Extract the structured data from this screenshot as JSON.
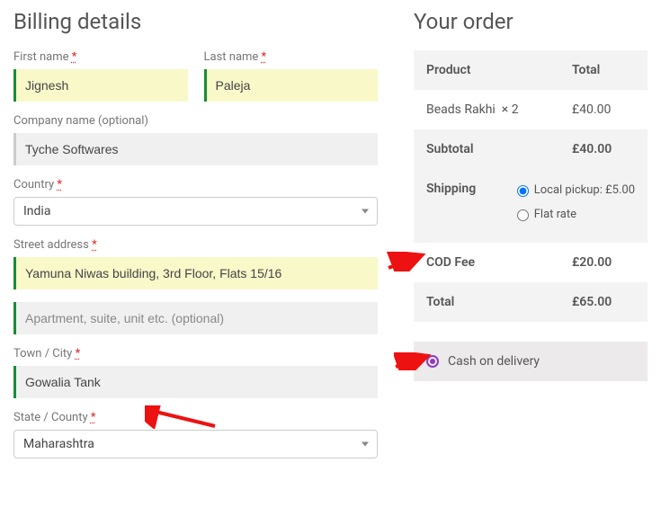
{
  "billing": {
    "heading": "Billing details",
    "first_name": {
      "label": "First name",
      "value": "Jignesh"
    },
    "last_name": {
      "label": "Last name",
      "value": "Paleja"
    },
    "company": {
      "label": "Company name (optional)",
      "value": "Tyche Softwares"
    },
    "country": {
      "label": "Country",
      "value": "India"
    },
    "street": {
      "label": "Street address",
      "value": "Yamuna Niwas building, 3rd Floor, Flats 15/16"
    },
    "street2_placeholder": "Apartment, suite, unit etc. (optional)",
    "city": {
      "label": "Town / City",
      "value": "Gowalia Tank"
    },
    "state": {
      "label": "State / County",
      "value": "Maharashtra"
    }
  },
  "order": {
    "heading": "Your order",
    "head_product": "Product",
    "head_total": "Total",
    "item_name": "Beads Rakhi",
    "item_qty": "× 2",
    "item_total": "£40.00",
    "subtotal_label": "Subtotal",
    "subtotal_value": "£40.00",
    "shipping_label": "Shipping",
    "shipping_options": {
      "local_pickup": "Local pickup: £5.00",
      "flat_rate": "Flat rate"
    },
    "cod_label": "COD Fee",
    "cod_value": "£20.00",
    "total_label": "Total",
    "total_value": "£65.00",
    "payment_cod": "Cash on delivery"
  }
}
